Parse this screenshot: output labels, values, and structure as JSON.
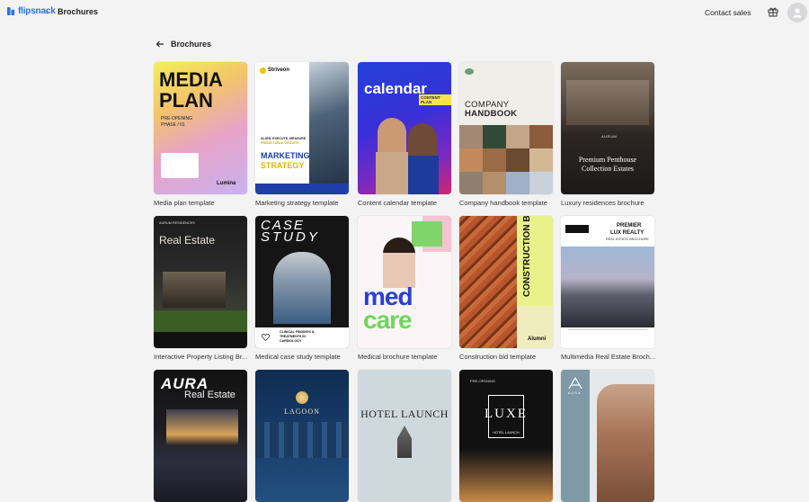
{
  "app": {
    "brand": "flipsnack",
    "breadcrumb": "Brochures",
    "contact_label": "Contact sales",
    "gift_icon": "gift-icon",
    "avatar_icon": "user-icon"
  },
  "page": {
    "title": "Brochures",
    "back_icon": "arrow-left-icon"
  },
  "templates": [
    {
      "label": "Media plan template",
      "t1": "MEDIA",
      "t2": "PLAN",
      "t3": "PRE-OPENING",
      "t4": "PHASE / 01",
      "t5": "Lumina"
    },
    {
      "label": "Marketing strategy template",
      "t1": "Striveon",
      "t2": "ALIGN, EXECUTE, MEASURE",
      "t3": "PREDICTABLE GROWTH",
      "t4": "MARKETING",
      "t5": "STRATEGY"
    },
    {
      "label": "Content calendar template",
      "t1": "calendar",
      "t2": "CONTENT PLAN"
    },
    {
      "label": "Company handbook template",
      "t1": "COMPANY",
      "t2": "HANDBOOK"
    },
    {
      "label": "Luxury residences brochure",
      "t1": "AURUM",
      "t2": "Premium Penthouse",
      "t3": "Collection Estates"
    },
    {
      "label": "Interactive Property Listing Br...",
      "t1": "AURUM RESIDENCES",
      "t2": "Real Estate"
    },
    {
      "label": "Medical case study template",
      "t1": "CASE",
      "t2": "STUDY",
      "t3": "CLINICAL FINDINGS &",
      "t4": "TREATMENTS IN",
      "t5": "CARDIOLOGY"
    },
    {
      "label": "Medical brochure template",
      "t1": "med",
      "t2": "care"
    },
    {
      "label": "Construction bid template",
      "t1": "CONSTRUCTION BID",
      "t2": "Alumni"
    },
    {
      "label": "Multimedia Real Estate Broch...",
      "t1": "PREMIER",
      "t2": "LUX REALTY",
      "t3": "REAL ESTATE BROCHURE"
    },
    {
      "label": "",
      "t1": "AURA",
      "t2": "Real Estate"
    },
    {
      "label": "",
      "t1": "LAGOON"
    },
    {
      "label": "",
      "t1": "HOTEL LAUNCH"
    },
    {
      "label": "",
      "t1": "PRE-OPENING",
      "t2": "LUXE",
      "t3": "HOTEL LAUNCH"
    },
    {
      "label": "",
      "t1": "AURA"
    }
  ],
  "colors": {
    "accent": "#2a72e6",
    "background": "#f3f3f4"
  }
}
